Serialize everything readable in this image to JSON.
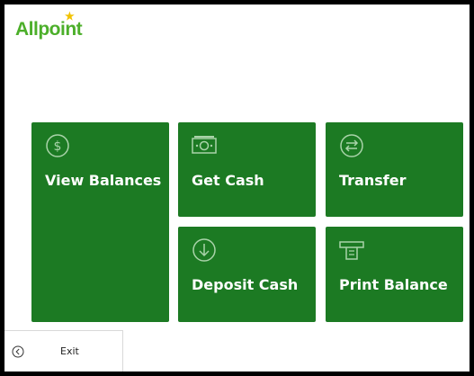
{
  "brand": {
    "name": "Allpoint"
  },
  "tiles": {
    "view_balances": {
      "label": "View Balances",
      "icon": "dollar-circle-icon"
    },
    "get_cash": {
      "label": "Get Cash",
      "icon": "banknote-icon"
    },
    "transfer": {
      "label": "Transfer",
      "icon": "transfer-arrows-icon"
    },
    "deposit_cash": {
      "label": "Deposit Cash",
      "icon": "arrow-down-circle-icon"
    },
    "print_balance": {
      "label": "Print Balance",
      "icon": "receipt-printer-icon"
    }
  },
  "exit": {
    "label": "Exit",
    "icon": "chevron-left-circle-icon"
  },
  "colors": {
    "tile": "#1c7a23",
    "brand": "#4caf2a",
    "brand_star": "#f2c200",
    "background": "#ffffff"
  }
}
